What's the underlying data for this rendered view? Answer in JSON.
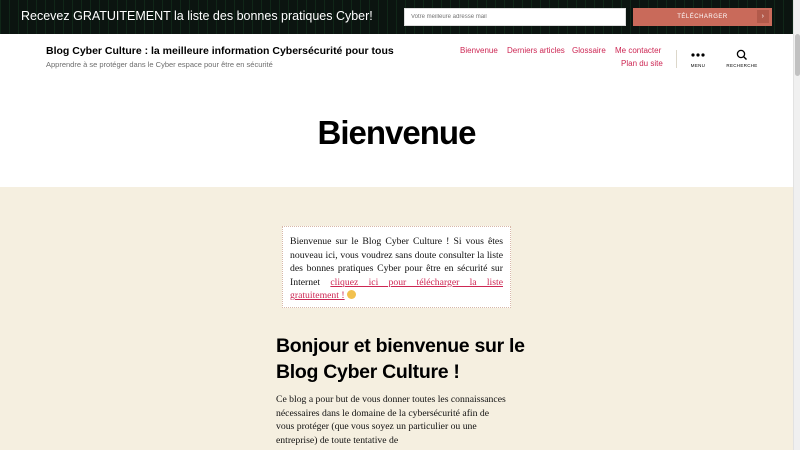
{
  "promo": {
    "text": "Recevez GRATUITEMENT la liste des bonnes pratiques Cyber!",
    "email_placeholder": "Votre meilleure adresse mail",
    "button_label": "TÉLÉCHARGER",
    "button_arrow": "›"
  },
  "header": {
    "site_title": "Blog Cyber Culture : la meilleure information Cybersécurité pour tous",
    "site_description": "Apprendre à se protéger dans le Cyber espace pour être en sécurité",
    "nav": [
      "Bienvenue",
      "Derniers articles",
      "Glossaire",
      "Me contacter",
      "Plan du site"
    ],
    "menu_label": "MENU",
    "search_label": "RECHERCHE"
  },
  "page": {
    "title": "Bienvenue",
    "notice_text": "Bienvenue sur le Blog Cyber Culture ! Si vous êtes nouveau ici, vous voudrez sans doute consulter la liste des bonnes pratiques Cyber pour être en sécurité sur Internet ",
    "notice_link": "cliquez ici pour télécharger la liste gratuitement !",
    "heading": "Bonjour et bienvenue sur le Blog Cyber Culture !",
    "body": "Ce blog a pour but de vous donner toutes les connaissances nécessaires dans le domaine de la cybersécurité afin de vous protéger (que vous soyez un particulier ou une entreprise) de toute tentative de"
  },
  "colors": {
    "accent": "#cd2653",
    "banner": "#0b1410",
    "cta": "#c96a5a",
    "content_bg": "#f5efe0"
  }
}
